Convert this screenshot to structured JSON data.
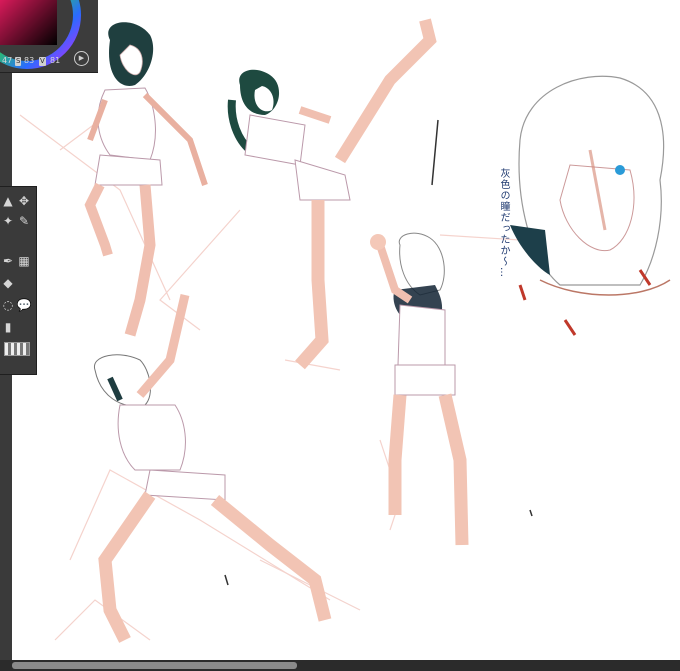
{
  "color_panel": {
    "h_value": "47",
    "s_tag": "S",
    "s_value": "83",
    "v_tag": "V",
    "v_value": "81"
  },
  "canvas": {
    "handwritten_note": "灰色の瞳だったか～…"
  },
  "tools": {
    "icons": [
      "move-icon",
      "eyedropper-icon",
      "pen-icon",
      "pattern-icon",
      "fill-icon",
      "lasso-icon",
      "speech-bubble-icon",
      "ruler-icon"
    ]
  }
}
